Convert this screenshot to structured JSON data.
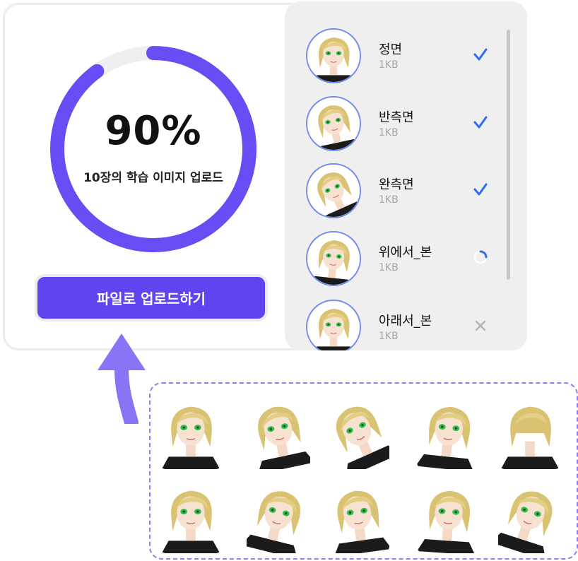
{
  "progress": {
    "percent_label": "90%",
    "value": 0.9,
    "caption": "10장의 학습 이미지 업로드",
    "track_color": "#efefef",
    "fill_color": "#6a4cf5"
  },
  "upload_button": {
    "label": "파일로 업로드하기",
    "color": "#5f45f0"
  },
  "files": [
    {
      "name": "정면",
      "size": "1KB",
      "status": "done",
      "status_icon": "check-icon"
    },
    {
      "name": "반측면",
      "size": "1KB",
      "status": "done",
      "status_icon": "check-icon"
    },
    {
      "name": "완측면",
      "size": "1KB",
      "status": "done",
      "status_icon": "check-icon"
    },
    {
      "name": "위에서_본",
      "size": "1KB",
      "status": "uploading",
      "status_icon": "spinner-icon"
    },
    {
      "name": "아래서_본",
      "size": "1KB",
      "status": "failed",
      "status_icon": "x-icon"
    }
  ],
  "gallery": {
    "count": 10,
    "images": [
      "front",
      "three-quarter-left",
      "profile-left",
      "from-above",
      "from-behind",
      "front-smile",
      "three-quarter-right",
      "side-glance",
      "front-soft",
      "from-below"
    ]
  },
  "colors": {
    "accent": "#5f45f0",
    "check": "#2d6df0",
    "avatar_border": "#6f8df0",
    "muted_text": "#a5a5a5"
  }
}
